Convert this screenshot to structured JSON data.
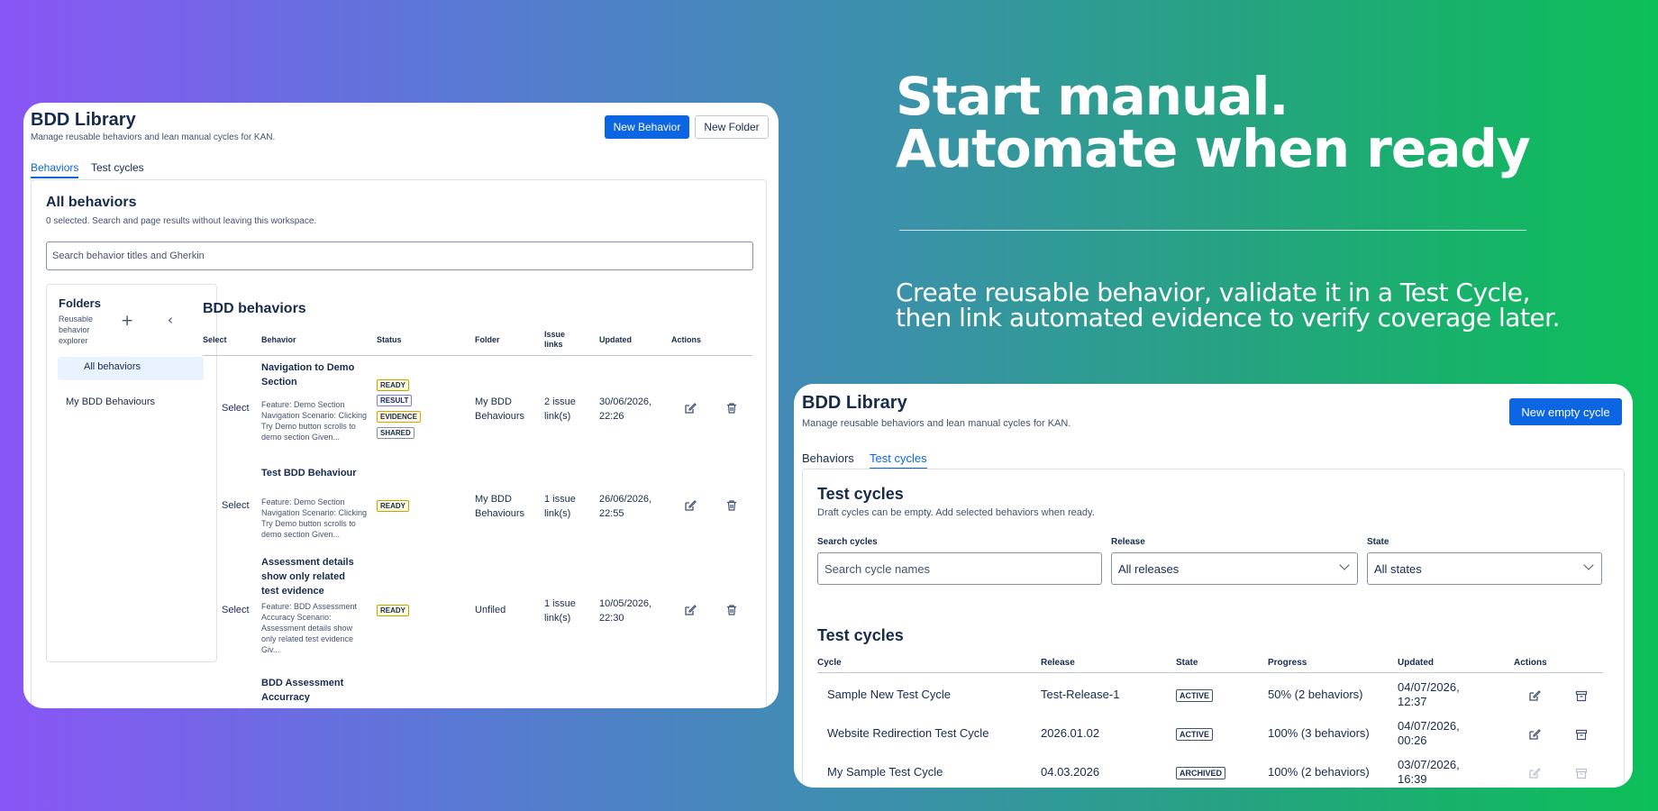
{
  "hero": {
    "title_line1": "Start manual.",
    "title_line2": "Automate when ready",
    "subtitle_line1": "Create reusable behavior, validate it in a Test Cycle,",
    "subtitle_line2": "then link automated evidence to verify coverage later."
  },
  "left_card": {
    "title": "BDD Library",
    "subtitle": "Manage reusable behaviors and lean manual cycles for KAN.",
    "new_behavior_label": "New Behavior",
    "new_folder_label": "New Folder",
    "tabs": [
      "Behaviors",
      "Test cycles"
    ],
    "section_title": "All behaviors",
    "section_note": "0 selected. Search and page results without leaving this workspace.",
    "search_placeholder": "Search behavior titles and Gherkin",
    "folders": {
      "title": "Folders",
      "subtitle": "Reusable behavior explorer",
      "items": [
        "All behaviors",
        "My BDD Behaviours"
      ]
    },
    "table": {
      "title": "BDD behaviors",
      "columns": [
        "Select",
        "Behavior",
        "Status",
        "Folder",
        "Issue links",
        "Updated",
        "Actions"
      ],
      "rows": [
        {
          "select": "Select",
          "title": "Navigation to Demo Section",
          "desc": "Feature: Demo Section Navigation Scenario: Clicking Try Demo button scrolls to demo section Given...",
          "statuses": [
            "READY",
            "RESULT",
            "EVIDENCE",
            "SHARED"
          ],
          "folder": "My BDD Behaviours",
          "links": "2 issue link(s)",
          "updated": "30/06/2026, 22:26"
        },
        {
          "select": "Select",
          "title": "Test BDD Behaviour",
          "desc": "Feature: Demo Section Navigation Scenario: Clicking Try Demo button scrolls to demo section Given...",
          "statuses": [
            "READY"
          ],
          "folder": "My BDD Behaviours",
          "links": "1 issue link(s)",
          "updated": "26/06/2026, 22:55"
        },
        {
          "select": "Select",
          "title": "Assessment details show only related test evidence",
          "desc": "Feature: BDD Assessment Accuracy Scenario: Assessment details show only related test evidence Giv...",
          "statuses": [
            "READY"
          ],
          "folder": "Unfiled",
          "links": "1 issue link(s)",
          "updated": "10/05/2026, 22:30"
        },
        {
          "title": "BDD Assessment Accurracy"
        }
      ]
    }
  },
  "right_card": {
    "title": "BDD Library",
    "subtitle": "Manage reusable behaviors and lean manual cycles for KAN.",
    "new_cycle_label": "New empty cycle",
    "tabs": [
      "Behaviors",
      "Test cycles"
    ],
    "section_title": "Test cycles",
    "section_note": "Draft cycles can be empty. Add selected behaviors when ready.",
    "filters": {
      "search_label": "Search cycles",
      "search_placeholder": "Search cycle names",
      "release_label": "Release",
      "release_value": "All releases",
      "state_label": "State",
      "state_value": "All states"
    },
    "table": {
      "title": "Test cycles",
      "columns": [
        "Cycle",
        "Release",
        "State",
        "Progress",
        "Updated",
        "Actions"
      ],
      "rows": [
        {
          "cycle": "Sample New Test Cycle",
          "release": "Test-Release-1",
          "state": "ACTIVE",
          "progress": "50% (2 behaviors)",
          "updated": "04/07/2026, 12:37",
          "enabled": true
        },
        {
          "cycle": "Website Redirection Test Cycle",
          "release": "2026.01.02",
          "state": "ACTIVE",
          "progress": "100% (3 behaviors)",
          "updated": "04/07/2026, 00:26",
          "enabled": true
        },
        {
          "cycle": "My Sample Test Cycle",
          "release": "04.03.2026",
          "state": "ARCHIVED",
          "progress": "100% (2 behaviors)",
          "updated": "03/07/2026, 16:39",
          "enabled": false
        }
      ]
    }
  },
  "colors": {
    "accent": "#0c66e4",
    "text": "#172b4d",
    "selected_bg": "#e9f2ff"
  }
}
